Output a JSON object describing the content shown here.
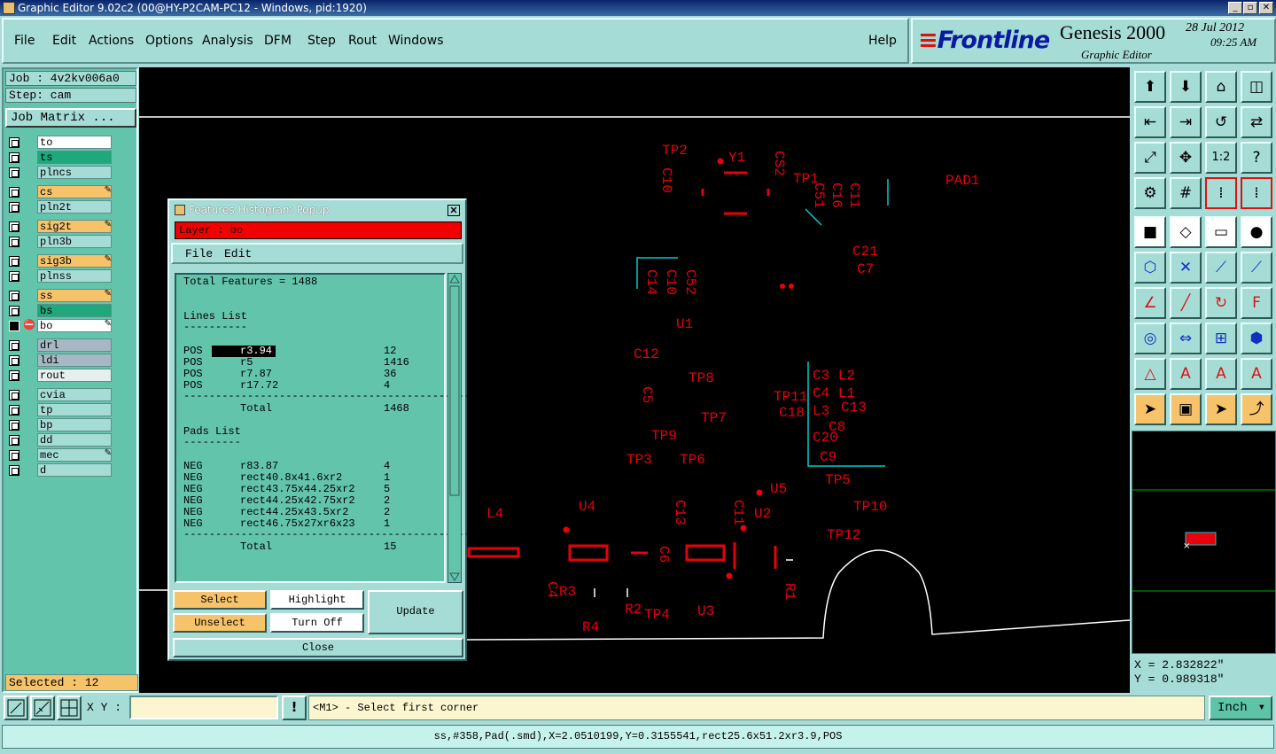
{
  "window": {
    "title": "Graphic Editor 9.02c2 (00@HY-P2CAM-PC12 - Windows, pid:1920)"
  },
  "menu": {
    "items": [
      "File",
      "Edit",
      "Actions",
      "Options",
      "Analysis",
      "DFM",
      "Step",
      "Rout",
      "Windows"
    ],
    "help": "Help"
  },
  "brand": {
    "logo": "Frontline",
    "product": "Genesis 2000",
    "subtitle": "Graphic Editor",
    "date": "28 Jul 2012",
    "time": "09:25 AM"
  },
  "job": {
    "job": "Job  : 4v2kv006a0",
    "step": "Step: cam",
    "matrix_button": "Job Matrix ..."
  },
  "layers": [
    {
      "name": "to",
      "color": "#ffffff",
      "mark": ""
    },
    {
      "name": "ts",
      "color": "#1fa87c",
      "mark": ""
    },
    {
      "name": "plncs",
      "color": "#a6dcd6",
      "mark": ""
    },
    {
      "name": "cs",
      "color": "#f6c36a",
      "mark": "✎"
    },
    {
      "name": "pln2t",
      "color": "#a6dcd6",
      "mark": ""
    },
    {
      "name": "sig2t",
      "color": "#f6c36a",
      "mark": "✎"
    },
    {
      "name": "pln3b",
      "color": "#a6dcd6",
      "mark": ""
    },
    {
      "name": "sig3b",
      "color": "#f6c36a",
      "mark": "✎"
    },
    {
      "name": "plnss",
      "color": "#a6dcd6",
      "mark": ""
    },
    {
      "name": "ss",
      "color": "#f6c36a",
      "mark": "✎"
    },
    {
      "name": "bs",
      "color": "#1fa87c",
      "mark": ""
    },
    {
      "name": "bo",
      "color": "#ffffff",
      "mark": "✎"
    },
    {
      "name": "drl",
      "color": "#a6b8c4",
      "mark": ""
    },
    {
      "name": "ldi",
      "color": "#a6b8c4",
      "mark": ""
    },
    {
      "name": "rout",
      "color": "#e6eeee",
      "mark": ""
    },
    {
      "name": "cvia",
      "color": "#a6dcd6",
      "mark": ""
    },
    {
      "name": "tp",
      "color": "#a6dcd6",
      "mark": ""
    },
    {
      "name": "bp",
      "color": "#a6dcd6",
      "mark": ""
    },
    {
      "name": "dd",
      "color": "#a6dcd6",
      "mark": ""
    },
    {
      "name": "mec",
      "color": "#a6dcd6",
      "mark": "✎"
    },
    {
      "name": "d",
      "color": "#a6dcd6",
      "mark": ""
    }
  ],
  "selected": "Selected : 12",
  "popup": {
    "title": "Features Histogram Popup",
    "layer": "Layer :  bo",
    "menu": [
      "File",
      "Edit"
    ],
    "total_features": "Total Features = 1488",
    "lines_header": "Lines List",
    "lines": [
      {
        "pol": "POS",
        "sym": "r3.94",
        "count": "12"
      },
      {
        "pol": "POS",
        "sym": "r5",
        "count": "1416"
      },
      {
        "pol": "POS",
        "sym": "r7.87",
        "count": "36"
      },
      {
        "pol": "POS",
        "sym": "r17.72",
        "count": "4"
      }
    ],
    "lines_total_label": "Total",
    "lines_total": "1468",
    "pads_header": "Pads List",
    "pads": [
      {
        "pol": "NEG",
        "sym": "r83.87",
        "count": "4"
      },
      {
        "pol": "NEG",
        "sym": "rect40.8x41.6xr2",
        "count": "1"
      },
      {
        "pol": "NEG",
        "sym": "rect43.75x44.25xr2",
        "count": "5"
      },
      {
        "pol": "NEG",
        "sym": "rect44.25x42.75xr2",
        "count": "2"
      },
      {
        "pol": "NEG",
        "sym": "rect44.25x43.5xr2",
        "count": "2"
      },
      {
        "pol": "NEG",
        "sym": "rect46.75x27xr6x23",
        "count": "1"
      }
    ],
    "pads_total_label": "Total",
    "pads_total": "15",
    "buttons": {
      "select": "Select",
      "highlight": "Highlight",
      "update": "Update",
      "unselect": "Unselect",
      "turn_off": "Turn Off",
      "close": "Close"
    }
  },
  "canvas_labels": [
    "TP2",
    "Y1",
    "CS2",
    "C10",
    "TP1",
    "PAD1",
    "C51",
    "C16",
    "C11",
    "C21",
    "C7",
    "C14",
    "C10",
    "C52",
    "U1",
    "C12",
    "TP8",
    "C5",
    "TP11",
    "C3",
    "L2",
    "C4",
    "L1",
    "C13",
    "L3",
    "C18",
    "C8",
    "TP7",
    "C20",
    "TP9",
    "C9",
    "TP3",
    "TP6",
    "TP5",
    "U5",
    "TP10",
    "L4",
    "U4",
    "C13",
    "C11",
    "U2",
    "TP12",
    "C6",
    "C4",
    "R3",
    "R4",
    "R2",
    "TP4",
    "U3",
    "R1"
  ],
  "coords": {
    "x": "X = 2.832822\"",
    "y": "Y = 0.989318\""
  },
  "bottom": {
    "xy_label": "X Y :",
    "xy_value": "",
    "exclaim": "!",
    "prompt": "<M1> - Select first corner",
    "unit": "Inch"
  },
  "status": "ss,#358,Pad(.smd),X=2.0510199,Y=0.3155541,rect25.6x51.2xr3.9,POS"
}
